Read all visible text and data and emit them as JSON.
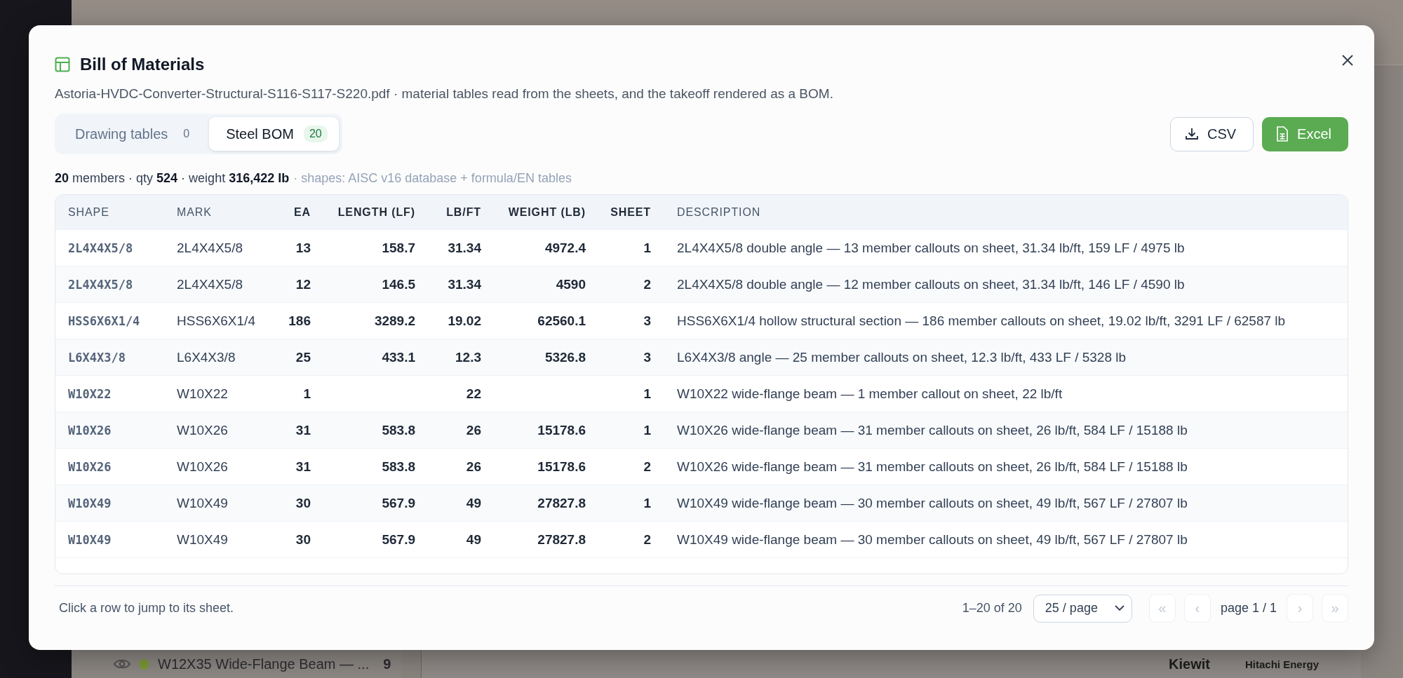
{
  "background": {
    "list_item": {
      "label": "W12X35 Wide-Flange Beam — ...",
      "count": "9",
      "color": "#7f9a3a"
    },
    "drawing_labels": [
      "Kiewit",
      "Hitachi Energy"
    ]
  },
  "dialog": {
    "title": "Bill of Materials",
    "subtitle": "Astoria-HVDC-Converter-Structural-S116-S117-S220.pdf · material tables read from the sheets, and the takeoff rendered as a BOM.",
    "tabs": [
      {
        "label": "Drawing tables",
        "count": "0",
        "selected": false
      },
      {
        "label": "Steel BOM",
        "count": "20",
        "selected": true
      }
    ],
    "buttons": [
      {
        "label": "CSV",
        "kind": "outline"
      },
      {
        "label": "Excel",
        "kind": "primary"
      }
    ],
    "summary": "**20** members · qty **524** · weight **316,422 lb**",
    "summary_note": "· shapes: AISC v16 database + formula/EN tables",
    "table": {
      "columns": [
        {
          "label": "SHAPE",
          "kind": "code"
        },
        {
          "label": "MARK",
          "kind": "text"
        },
        {
          "label": "EA",
          "kind": "number"
        },
        {
          "label": "LENGTH (LF)",
          "kind": "number"
        },
        {
          "label": "LB/FT",
          "kind": "number"
        },
        {
          "label": "WEIGHT (LB)",
          "kind": "number"
        },
        {
          "label": "SHEET",
          "kind": "sheet"
        },
        {
          "label": "DESCRIPTION",
          "kind": "desc"
        }
      ],
      "rows": [
        [
          "2L4X4X5/8",
          "2L4X4X5/8",
          "13",
          "158.7",
          "31.34",
          "4972.4",
          "1",
          "2L4X4X5/8 double angle — 13 member callouts on sheet, 31.34 lb/ft, 159 LF / 4975 lb"
        ],
        [
          "2L4X4X5/8",
          "2L4X4X5/8",
          "12",
          "146.5",
          "31.34",
          "4590",
          "2",
          "2L4X4X5/8 double angle — 12 member callouts on sheet, 31.34 lb/ft, 146 LF / 4590 lb"
        ],
        [
          "HSS6X6X1/4",
          "HSS6X6X1/4",
          "186",
          "3289.2",
          "19.02",
          "62560.1",
          "3",
          "HSS6X6X1/4 hollow structural section — 186 member callouts on sheet, 19.02 lb/ft, 3291 LF / 62587 lb"
        ],
        [
          "L6X4X3/8",
          "L6X4X3/8",
          "25",
          "433.1",
          "12.3",
          "5326.8",
          "3",
          "L6X4X3/8 angle — 25 member callouts on sheet, 12.3 lb/ft, 433 LF / 5328 lb"
        ],
        [
          "W10X22",
          "W10X22",
          "1",
          "",
          "22",
          "",
          "1",
          "W10X22 wide-flange beam — 1 member callout on sheet, 22 lb/ft"
        ],
        [
          "W10X26",
          "W10X26",
          "31",
          "583.8",
          "26",
          "15178.6",
          "1",
          "W10X26 wide-flange beam — 31 member callouts on sheet, 26 lb/ft, 584 LF / 15188 lb"
        ],
        [
          "W10X26",
          "W10X26",
          "31",
          "583.8",
          "26",
          "15178.6",
          "2",
          "W10X26 wide-flange beam — 31 member callouts on sheet, 26 lb/ft, 584 LF / 15188 lb"
        ],
        [
          "W10X49",
          "W10X49",
          "30",
          "567.9",
          "49",
          "27827.8",
          "1",
          "W10X49 wide-flange beam — 30 member callouts on sheet, 49 lb/ft, 567 LF / 27807 lb"
        ],
        [
          "W10X49",
          "W10X49",
          "30",
          "567.9",
          "49",
          "27827.8",
          "2",
          "W10X49 wide-flange beam — 30 member callouts on sheet, 49 lb/ft, 567 LF / 27807 lb"
        ]
      ]
    },
    "footer": {
      "hint": "Click a row to jump to its sheet.",
      "range": "1–20 of 20",
      "page_size": "25 / page",
      "page_label": "page 1 / 1",
      "pager_before": [
        {
          "label": "«",
          "disabled": true
        },
        {
          "label": "‹",
          "disabled": true
        }
      ],
      "pager_after": [
        {
          "label": "›",
          "disabled": true
        },
        {
          "label": "»",
          "disabled": true
        }
      ]
    }
  }
}
